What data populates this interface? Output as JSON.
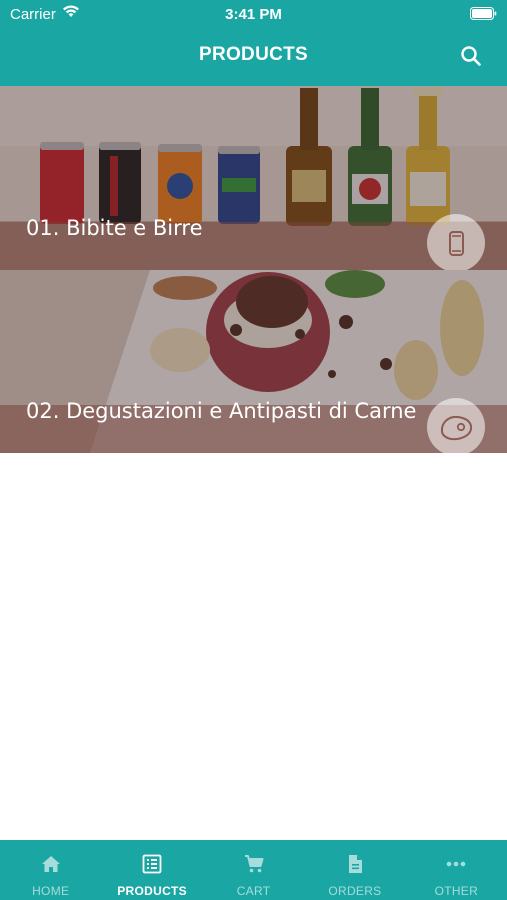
{
  "status_bar": {
    "carrier": "Carrier",
    "time": "3:41 PM",
    "wifi_icon": "wifi-icon",
    "battery_icon": "battery-icon"
  },
  "nav": {
    "title": "PRODUCTS",
    "search_icon": "search-icon"
  },
  "categories": [
    {
      "label": "01. Bibite e Birre",
      "icon": "can-icon"
    },
    {
      "label": "02. Degustazioni e Antipasti di Carne",
      "icon": "steak-icon"
    }
  ],
  "tab_bar": {
    "active": "PRODUCTS",
    "tabs": [
      {
        "label": "HOME",
        "icon": "home-icon"
      },
      {
        "label": "PRODUCTS",
        "icon": "list-icon"
      },
      {
        "label": "CART",
        "icon": "cart-icon"
      },
      {
        "label": "ORDERS",
        "icon": "document-icon"
      },
      {
        "label": "OTHER",
        "icon": "more-icon"
      }
    ]
  },
  "colors": {
    "accent": "#1aa7a4",
    "inactive_tab": "#a6dcdb",
    "label_band": "#78463c"
  }
}
